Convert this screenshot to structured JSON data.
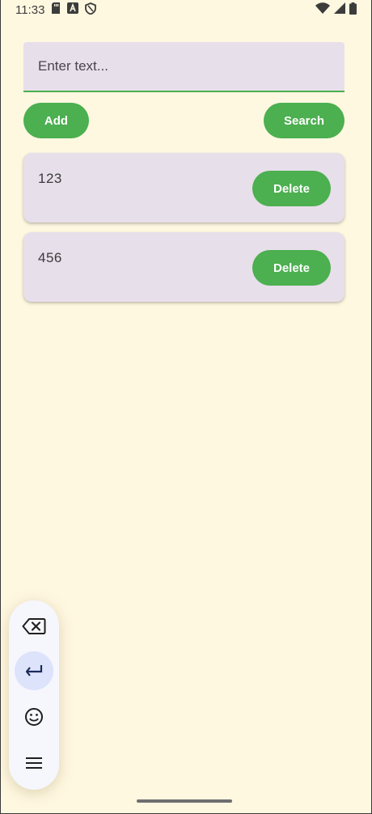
{
  "status_bar": {
    "time": "11:33",
    "left_icons": [
      "sd-card-icon",
      "font-a-icon",
      "shield-icon"
    ],
    "right_icons": [
      "wifi-icon",
      "signal-icon",
      "battery-icon"
    ]
  },
  "input": {
    "placeholder": "Enter text...",
    "value": ""
  },
  "buttons": {
    "add": "Add",
    "search": "Search"
  },
  "items": [
    {
      "text": "123",
      "delete_label": "Delete"
    },
    {
      "text": "456",
      "delete_label": "Delete"
    }
  ],
  "toolbar": {
    "items": [
      "backspace-icon",
      "enter-icon",
      "emoji-icon",
      "menu-icon"
    ],
    "active": "enter-icon"
  },
  "colors": {
    "background": "#fff8e1",
    "accent": "#4caf50",
    "surface": "#e7dfea"
  }
}
